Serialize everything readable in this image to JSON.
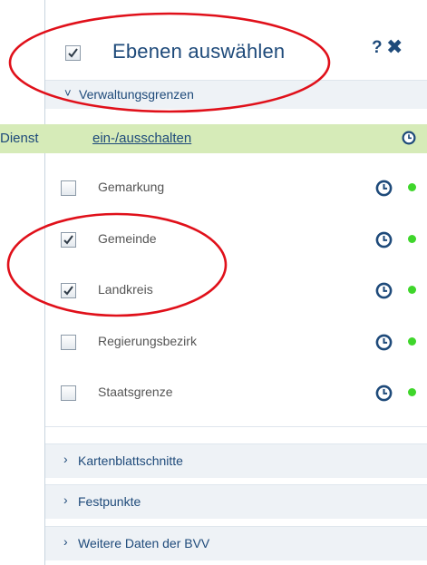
{
  "header": {
    "title": "Ebenen auswählen",
    "help_label": "?",
    "close_label": "✖",
    "checked": true
  },
  "group": {
    "name": "Verwaltungsgrenzen",
    "expanded": true
  },
  "service": {
    "prefix": "Dienst ",
    "link_text": "ein-/ausschalten"
  },
  "layers": [
    {
      "name": "Gemarkung",
      "checked": false
    },
    {
      "name": "Gemeinde",
      "checked": true
    },
    {
      "name": "Landkreis",
      "checked": true
    },
    {
      "name": "Regierungsbezirk",
      "checked": false
    },
    {
      "name": "Staatsgrenze",
      "checked": false
    }
  ],
  "collapsed_groups": [
    {
      "name": "Kartenblattschnitte"
    },
    {
      "name": "Festpunkte"
    },
    {
      "name": "Weitere Daten der BVV"
    }
  ],
  "colors": {
    "accent": "#1e4a7a",
    "service_bar": "#d6ebb8",
    "status_dot": "#3fd62b",
    "annotation": "#e0101a"
  }
}
